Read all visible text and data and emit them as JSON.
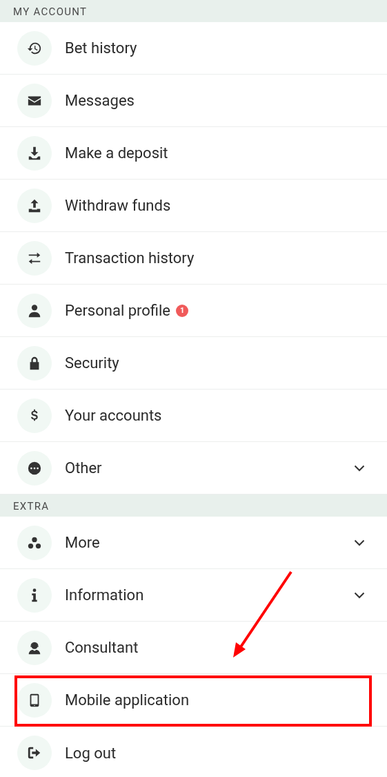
{
  "sections": [
    {
      "title": "MY ACCOUNT",
      "items": [
        {
          "label": "Bet history",
          "kind": "link",
          "highlighted": false
        },
        {
          "label": "Messages",
          "kind": "link",
          "highlighted": false
        },
        {
          "label": "Make a deposit",
          "kind": "link",
          "highlighted": false
        },
        {
          "label": "Withdraw funds",
          "kind": "link",
          "highlighted": false
        },
        {
          "label": "Transaction history",
          "kind": "link",
          "highlighted": false
        },
        {
          "label": "Personal profile",
          "kind": "link",
          "badge": "1",
          "highlighted": false
        },
        {
          "label": "Security",
          "kind": "link",
          "highlighted": false
        },
        {
          "label": "Your accounts",
          "kind": "link",
          "highlighted": false
        },
        {
          "label": "Other",
          "kind": "expandable",
          "expanded": false,
          "highlighted": false
        }
      ]
    },
    {
      "title": "EXTRA",
      "items": [
        {
          "label": "More",
          "kind": "expandable",
          "expanded": false,
          "highlighted": false
        },
        {
          "label": "Information",
          "kind": "expandable",
          "expanded": false,
          "highlighted": false
        },
        {
          "label": "Consultant",
          "kind": "link",
          "highlighted": false
        },
        {
          "label": "Mobile application",
          "kind": "link",
          "highlighted": true
        },
        {
          "label": "Log out",
          "kind": "link",
          "highlighted": false
        }
      ]
    }
  ]
}
